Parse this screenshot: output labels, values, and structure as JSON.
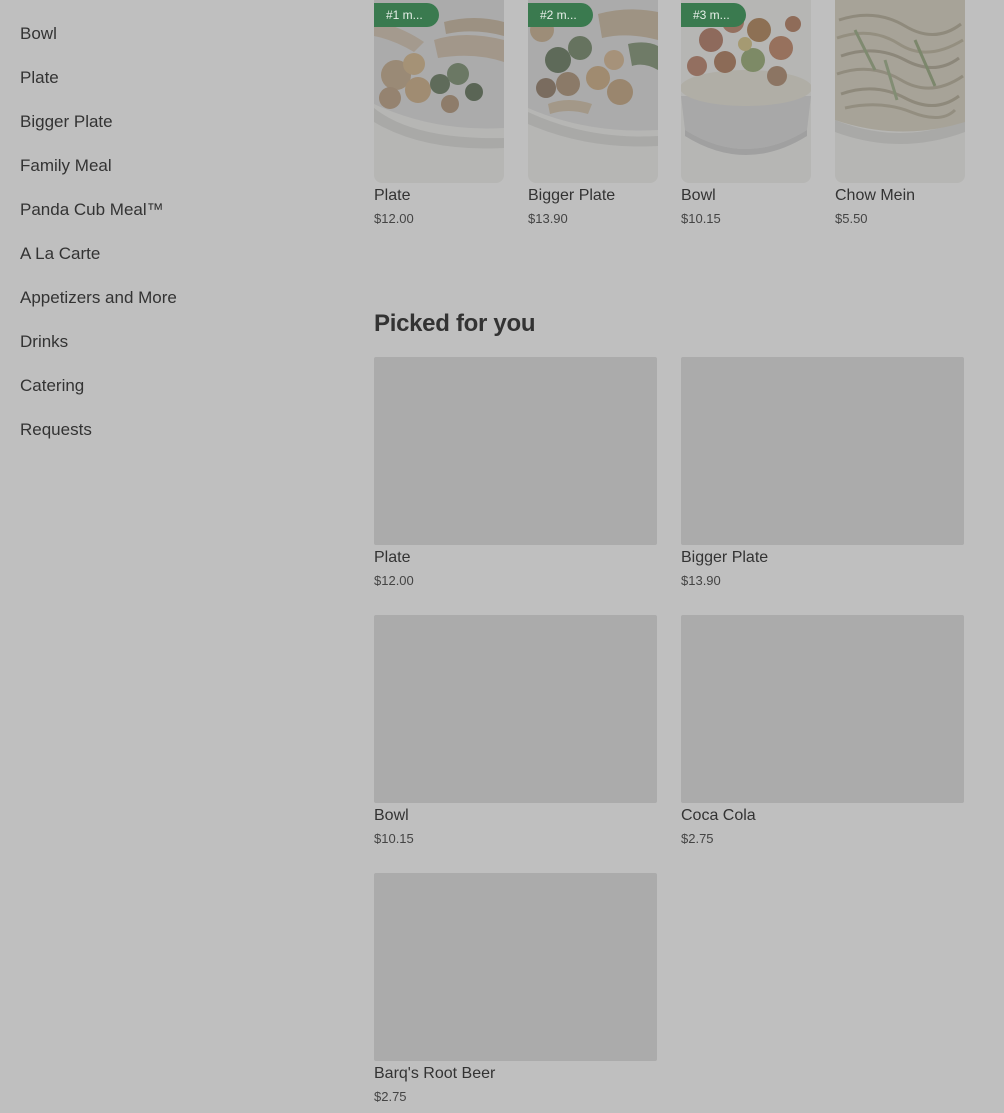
{
  "sidebar": {
    "items": [
      {
        "label": "Bowl"
      },
      {
        "label": "Plate"
      },
      {
        "label": "Bigger Plate"
      },
      {
        "label": "Family Meal"
      },
      {
        "label": "Panda Cub Meal™"
      },
      {
        "label": "A La Carte"
      },
      {
        "label": "Appetizers and More"
      },
      {
        "label": "Drinks"
      },
      {
        "label": "Catering"
      },
      {
        "label": "Requests"
      }
    ]
  },
  "featured": {
    "items": [
      {
        "badge": "#1 m...",
        "name": "Plate",
        "price": "$12.00",
        "image": "plate-food-image"
      },
      {
        "badge": "#2 m...",
        "name": "Bigger Plate",
        "price": "$13.90",
        "image": "bigger-plate-food-image"
      },
      {
        "badge": "#3 m...",
        "name": "Bowl",
        "price": "$10.15",
        "image": "bowl-food-image"
      },
      {
        "badge": "",
        "name": "Chow Mein",
        "price": "$5.50",
        "image": "chow-mein-food-image"
      }
    ],
    "badge_color": "#3a7a4f"
  },
  "picked": {
    "title": "Picked for you",
    "items": [
      {
        "name": "Plate",
        "price": "$12.00"
      },
      {
        "name": "Bigger Plate",
        "price": "$13.90"
      },
      {
        "name": "Bowl",
        "price": "$10.15"
      },
      {
        "name": "Coca Cola",
        "price": "$2.75"
      },
      {
        "name": "Barq's Root Beer",
        "price": "$2.75"
      }
    ]
  },
  "theme": {
    "overlay_background": "#bfbfbf",
    "placeholder": "#ababab",
    "text": "#333333"
  }
}
